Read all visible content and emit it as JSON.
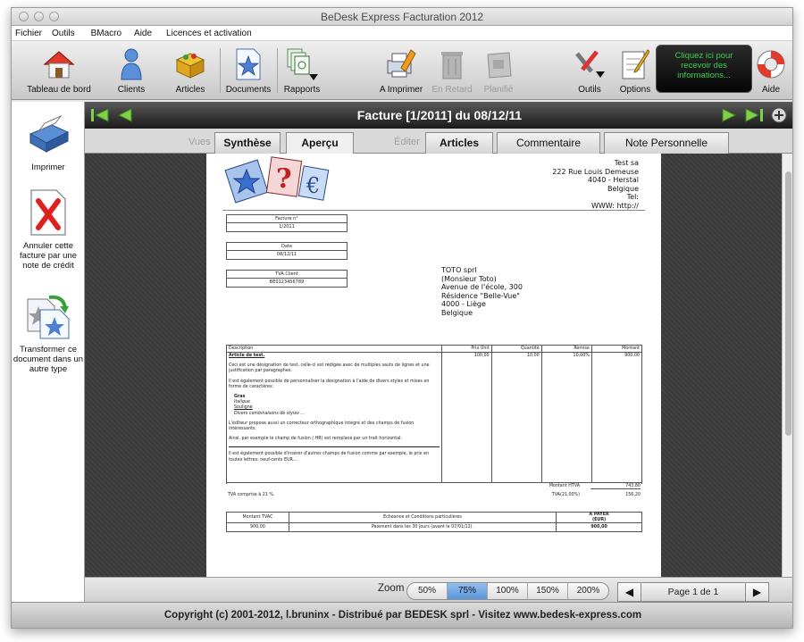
{
  "window": {
    "title": "BeDesk Express Facturation 2012"
  },
  "menu": [
    "Fichier",
    "Outils",
    "BMacro",
    "Aide",
    "Licences et activation"
  ],
  "toolbar": {
    "dashboard": "Tableau de bord",
    "clients": "Clients",
    "articles": "Articles",
    "documents": "Documents",
    "reports": "Rapports",
    "to_print": "A Imprimer",
    "late": "En Retard",
    "planned": "Planifié",
    "tools": "Outils",
    "options": "Options",
    "promo": "Cliquez ici pour recevoir des informations...",
    "help": "Aide"
  },
  "sidebar": {
    "print": "Imprimer",
    "cancel": "Annuler cette facture par une note de crédit",
    "transform": "Transformer ce document dans un autre type"
  },
  "nav": {
    "title": "Facture [1/2011] du 08/12/11"
  },
  "tabs": {
    "views_label": "Vues",
    "synthese": "Synthèse",
    "apercu": "Aperçu",
    "edit_label": "Éditer",
    "articles": "Articles",
    "comment": "Commentaire",
    "note": "Note Personnelle"
  },
  "invoice": {
    "sender": [
      "Test sa",
      "222 Rue Louis Demeuse",
      "4040 - Herstal",
      "Belgique",
      "Tel:",
      "WWW: http://"
    ],
    "invoice_no_label": "Facture n°",
    "invoice_no": "1/2011",
    "date_label": "Date",
    "date": "08/12/11",
    "vat_label": "TVA Client",
    "vat": "BE0123456789",
    "client": [
      "TOTO sprl",
      "(Monsieur Toto)",
      "Avenue de l'école, 300",
      "Résidence \"Belle-Vue\"",
      "4000 - Liège",
      "Belgique"
    ],
    "columns": [
      "Description",
      "Prix Unit",
      "Quantité",
      "Remise",
      "Montant"
    ],
    "line": {
      "title": "Article de test.",
      "p1": "Ceci est une désignation de test, celle-ci est rédigée avec de multiples sauts de lignes et une justification par paragraphes.",
      "p2": "Il est également possible de personnaliser la désignation à l'aide de divers styles et mises en forme de caractères:",
      "styles": [
        "Gras",
        "Italique",
        "Souligné",
        "Divers combinaisons de styles ..."
      ],
      "p3": "L'éditeur propose aussi un correcteur orthographique intégré et des champs de fusion intéressants.",
      "p4": "Ainsi, par exemple le champ de fusion ( HR) est remplacé par un trait horizontal:",
      "p5": "Il est également possible d'insérer d'autres champs de fusion comme par exemple, le prix en toutes lettres: neuf-cents EUR....",
      "unit_price": "100,00",
      "qty": "10,00",
      "discount": "10,00%",
      "amount": "900,00"
    },
    "totals": {
      "htva_label": "Montant HTVA",
      "htva": "743,80",
      "tva_label": "TVA(21,00%)",
      "tva": "156,20",
      "tva_note": "TVA comprise à 21 %."
    },
    "recap": {
      "tvac_label": "Montant TVAC",
      "terms_label": "Échéance et Conditions particulières",
      "pay_label": "A PAYER",
      "pay_unit": "(EUR)",
      "tvac": "900,00",
      "terms": "Paiement dans les 30 jours (avant le 07/01/12).",
      "pay": "900,00"
    }
  },
  "zoom": {
    "label": "Zoom",
    "options": [
      "50%",
      "75%",
      "100%",
      "150%",
      "200%"
    ],
    "selected": "75%"
  },
  "pager": {
    "text": "Page 1 de 1"
  },
  "footer": "Copyright (c) 2001-2012, l.bruninx - Distribué par BEDESK sprl - Visitez www.bedesk-express.com"
}
